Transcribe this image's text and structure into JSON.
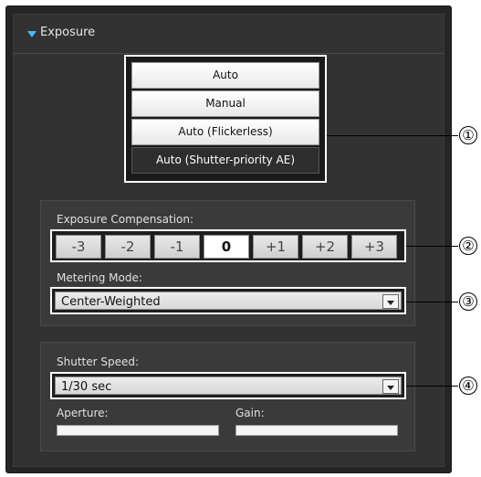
{
  "header": {
    "title": "Exposure"
  },
  "mode": {
    "buttons": [
      "Auto",
      "Manual",
      "Auto (Flickerless)",
      "Auto (Shutter-priority AE)"
    ],
    "selected_index": 3
  },
  "compensation": {
    "label": "Exposure Compensation:",
    "values": [
      "-3",
      "-2",
      "-1",
      "0",
      "+1",
      "+2",
      "+3"
    ],
    "selected_index": 3
  },
  "metering": {
    "label": "Metering Mode:",
    "value": "Center-Weighted"
  },
  "shutter": {
    "label": "Shutter Speed:",
    "value": "1/30 sec"
  },
  "aperture": {
    "label": "Aperture:"
  },
  "gain": {
    "label": "Gain:"
  },
  "callouts": [
    "①",
    "②",
    "③",
    "④"
  ]
}
